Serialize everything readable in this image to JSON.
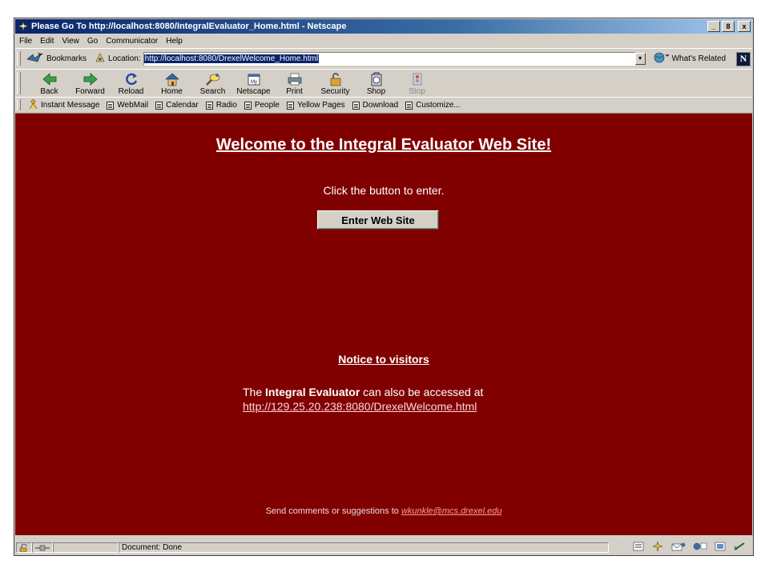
{
  "window": {
    "title": "Please Go To http://localhost:8080/IntegralEvaluator_Home.html - Netscape",
    "controls": [
      "_",
      "8",
      "x"
    ]
  },
  "menu": [
    "File",
    "Edit",
    "View",
    "Go",
    "Communicator",
    "Help"
  ],
  "location_bar": {
    "bookmarks_label": "Bookmarks",
    "location_label": "Location:",
    "url": "http://localhost:8080/DrexelWelcome_Home.html",
    "whats_related_label": "What's Related",
    "logo_letter": "N"
  },
  "nav_buttons": [
    {
      "label": "Back",
      "icon": "back-arrow-icon"
    },
    {
      "label": "Forward",
      "icon": "forward-arrow-icon"
    },
    {
      "label": "Reload",
      "icon": "reload-icon"
    },
    {
      "label": "Home",
      "icon": "home-icon"
    },
    {
      "label": "Search",
      "icon": "search-icon"
    },
    {
      "label": "Netscape",
      "icon": "netscape-icon"
    },
    {
      "label": "Print",
      "icon": "print-icon"
    },
    {
      "label": "Security",
      "icon": "lock-icon"
    },
    {
      "label": "Shop",
      "icon": "shop-icon"
    },
    {
      "label": "Stop",
      "icon": "stop-icon"
    }
  ],
  "personal_bar": [
    "Instant Message",
    "WebMail",
    "Calendar",
    "Radio",
    "People",
    "Yellow Pages",
    "Download",
    "Customize..."
  ],
  "page": {
    "welcome": "Welcome to the Integral Evaluator Web Site!",
    "click_text": "Click the button to enter.",
    "enter_button": "Enter Web Site",
    "notice_heading": "Notice to visitors",
    "access_prefix": "The ",
    "access_bold": "Integral Evaluator",
    "access_suffix": " can also be accessed at",
    "access_link": "http://129.25.20.238:8080/DrexelWelcome.html",
    "comments_prefix": "Send comments or suggestions to ",
    "comments_email": "wkunkle@mcs.drexel.edu"
  },
  "status": {
    "text": "Document: Done"
  },
  "colors": {
    "page_background": "#800000",
    "chrome": "#d4d0c8",
    "titlebar": "#0a246a"
  }
}
